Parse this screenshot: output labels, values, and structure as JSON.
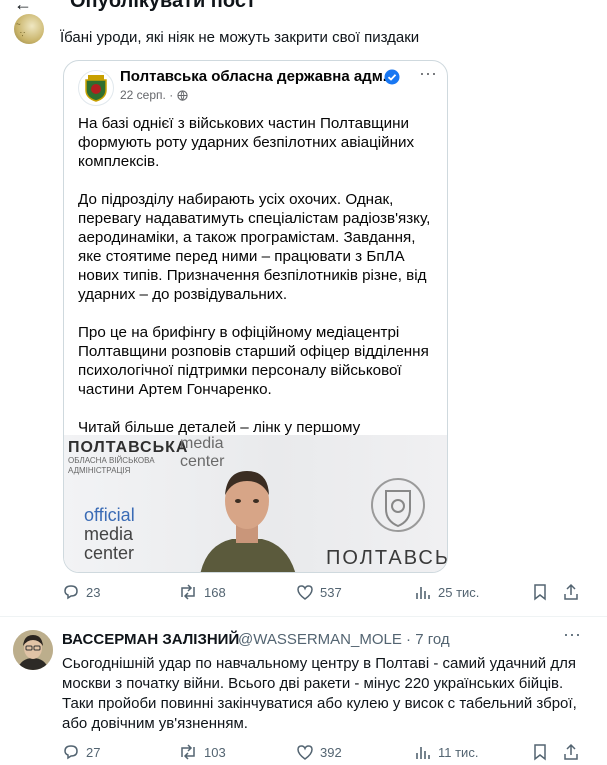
{
  "header": {
    "title": "Опублікувати пост",
    "back_icon": "arrow-left-icon"
  },
  "reply": {
    "text": "Їбані уроди, які ніяк не можуть закрити свої пиздаки"
  },
  "embedded_post": {
    "page_name": "Полтавська обласна державна адм...",
    "date": "22 серп.",
    "separator": "·",
    "paragraphs": [
      "На базі однієї з військових частин Полтавщини формують роту ударних  безпілотних авіаційних комплексів.",
      "До підрозділу набирають усіх охочих. Однак, перевагу надаватимуть спеціалістам радіозв'язку, аеродинаміки, а також програмістам. Завдання, яке стоятиме перед ними – працювати з БпЛА нових типів. Призначення безпілотників різне, від ударних – до розвідувальних.",
      "Про це на брифінгу в офіційному медіацентрі Полтавщини розповів старший офіцер відділення психологічної підтримки персоналу військової частини Артем Гончаренко.",
      "Читай більше деталей – лінк у першому коментарі."
    ],
    "photo": {
      "poltava_top": "ПОЛТАВСЬКА",
      "adm_line": "ОБЛАСНА ВІЙСЬКОВА АДМІНІСТРАЦІЯ",
      "media_top": "media\ncenter",
      "official": "official",
      "media": "media",
      "center": "center",
      "poltava_bottom": "ПОЛТАВСЬ"
    }
  },
  "post_actions": {
    "replies": "23",
    "reposts": "168",
    "likes": "537",
    "views": "25 тис."
  },
  "second_post": {
    "display_name": "ВАССЕРМАН ЗАЛІЗНИЙ",
    "handle": "@WASSERMAN_MOLE · 7 год",
    "text": "Сьогоднішній удар по навчальному центру в Полтаві - самий удачний для москви з початку війни. Всього дві ракети - мінус 220 українських бійців. Таки пройоби повинні закінчуватися або кулею у висок с табельний зброї, або довічним ув'язненням.",
    "actions": {
      "replies": "27",
      "reposts": "103",
      "likes": "392",
      "views": "11 тис."
    }
  },
  "colors": {
    "text": "#0f1419",
    "muted": "#536471",
    "border": "#cfd9de",
    "verified": "#1877f2"
  }
}
